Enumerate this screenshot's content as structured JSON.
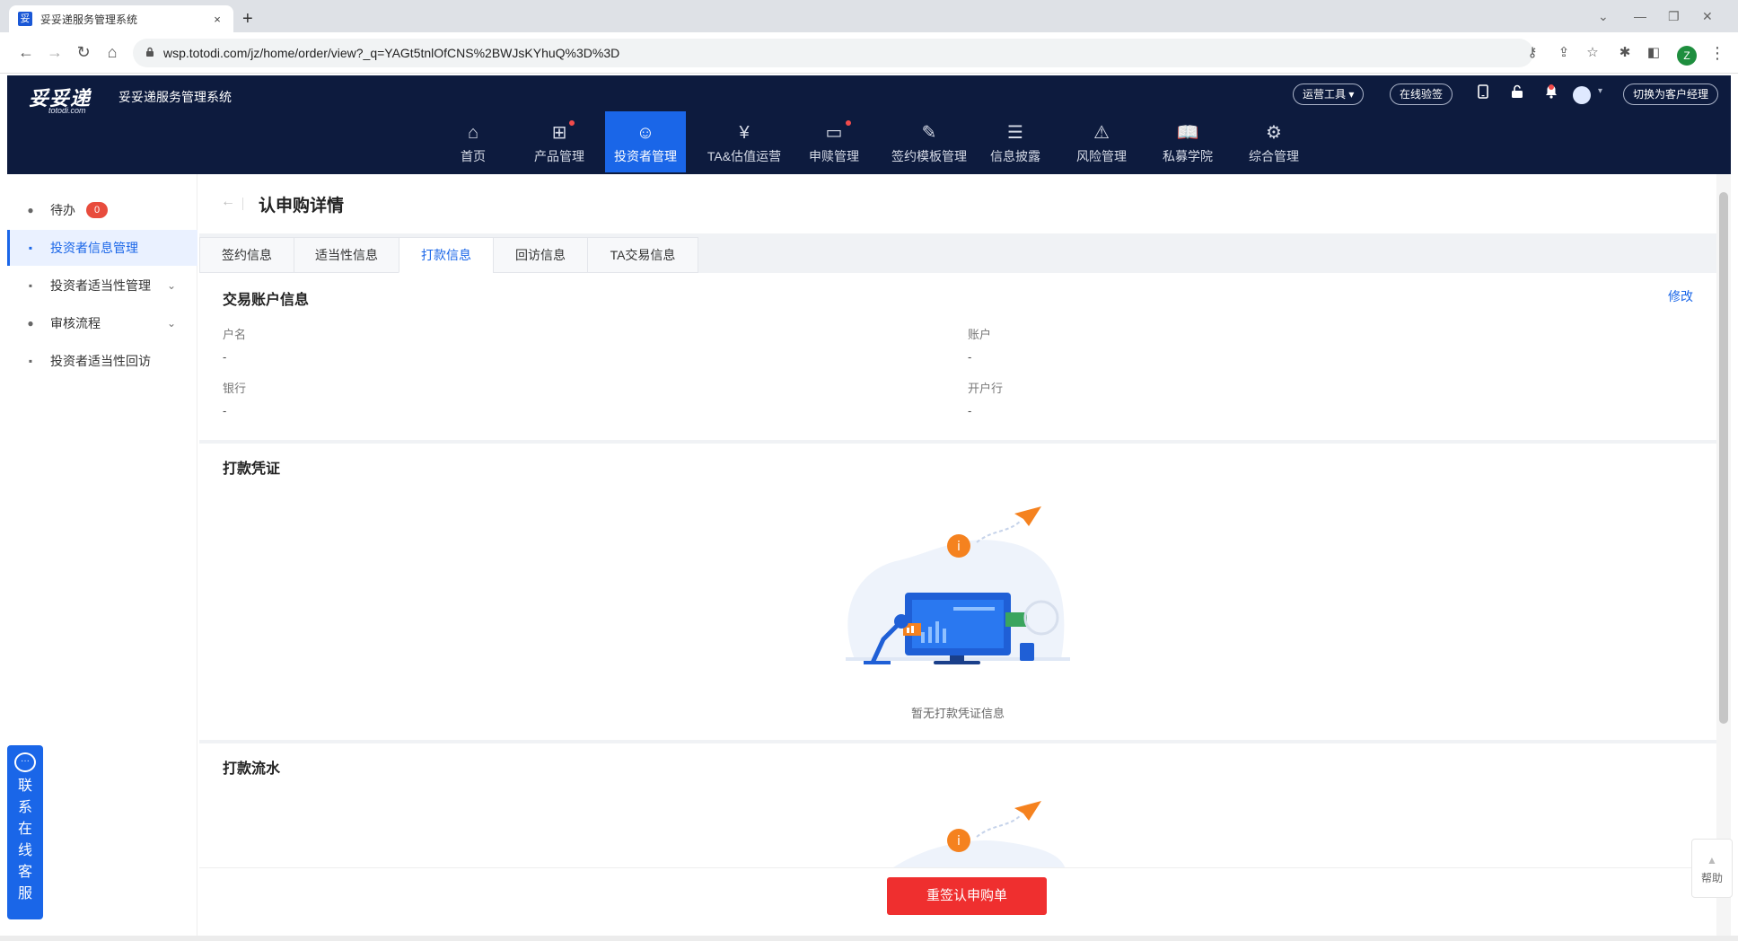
{
  "browser": {
    "tab_title": "妥妥递服务管理系统",
    "favicon_char": "妥",
    "new_tab": "+",
    "close_char": "×",
    "url": "wsp.totodi.com/jz/home/order/view?_q=YAGt5tnlOfCNS%2BWJsKYhuQ%3D%3D",
    "profile_initial": "Z",
    "controls": {
      "collapse": "⌄",
      "minimize": "—",
      "restore": "❐",
      "close": "✕"
    },
    "nav": {
      "back": "←",
      "forward": "→",
      "reload": "↻",
      "home": "⌂"
    },
    "omni_icons": {
      "key": "⚷",
      "share": "⇪",
      "star": "☆",
      "extensions": "✱",
      "sidepanel": "◧",
      "menu": "⋮",
      "lock": "🔒"
    }
  },
  "app": {
    "logo_text": "妥妥递",
    "logo_sub": "totodi.com",
    "system_title": "妥妥递服务管理系统",
    "header_actions": {
      "ops_tools": "运营工具 ▾",
      "online_sign": "在线验签",
      "switch_role": "切换为客户经理"
    },
    "nav_items": [
      {
        "label": "首页",
        "icon": "⌂",
        "dot": false
      },
      {
        "label": "产品管理",
        "icon": "⊞",
        "dot": true
      },
      {
        "label": "投资者管理",
        "icon": "☺",
        "dot": false,
        "active": true
      },
      {
        "label": "TA&估值运营",
        "icon": "¥",
        "dot": false
      },
      {
        "label": "申赎管理",
        "icon": "▭",
        "dot": true
      },
      {
        "label": "签约模板管理",
        "icon": "✎",
        "dot": false
      },
      {
        "label": "信息披露",
        "icon": "☰",
        "dot": false
      },
      {
        "label": "风险管理",
        "icon": "⚠",
        "dot": false
      },
      {
        "label": "私募学院",
        "icon": "📖",
        "dot": false
      },
      {
        "label": "综合管理",
        "icon": "⚙",
        "dot": false
      }
    ]
  },
  "sidebar": {
    "items": [
      {
        "label": "待办",
        "icon": "●",
        "badge": "0"
      },
      {
        "label": "投资者信息管理",
        "icon": "▪",
        "active": true
      },
      {
        "label": "投资者适当性管理",
        "icon": "▪",
        "chevron": "⌄"
      },
      {
        "label": "审核流程",
        "icon": "●",
        "chevron": "⌄"
      },
      {
        "label": "投资者适当性回访",
        "icon": "▪"
      }
    ]
  },
  "chat_widget": {
    "icon": "···",
    "text": "联系在线客服"
  },
  "page": {
    "back": "←",
    "title": "认申购详情",
    "tabs": [
      "签约信息",
      "适当性信息",
      "打款信息",
      "回访信息",
      "TA交易信息"
    ],
    "active_tab": "打款信息",
    "account_section": {
      "title": "交易账户信息",
      "edit": "修改",
      "fields": [
        {
          "label": "户名",
          "value": "-"
        },
        {
          "label": "账户",
          "value": "-"
        },
        {
          "label": "银行",
          "value": "-"
        },
        {
          "label": "开户行",
          "value": "-"
        }
      ]
    },
    "voucher_section": {
      "title": "打款凭证",
      "empty": "暂无打款凭证信息"
    },
    "flow_section": {
      "title": "打款流水"
    },
    "primary_button": "重签认申购单"
  },
  "help": {
    "arrow": "▲",
    "label": "帮助"
  },
  "colors": {
    "header_bg": "#0d1b3e",
    "accent": "#1a66e8",
    "danger": "#ef2f2f",
    "illustration_orange": "#f5821f"
  }
}
